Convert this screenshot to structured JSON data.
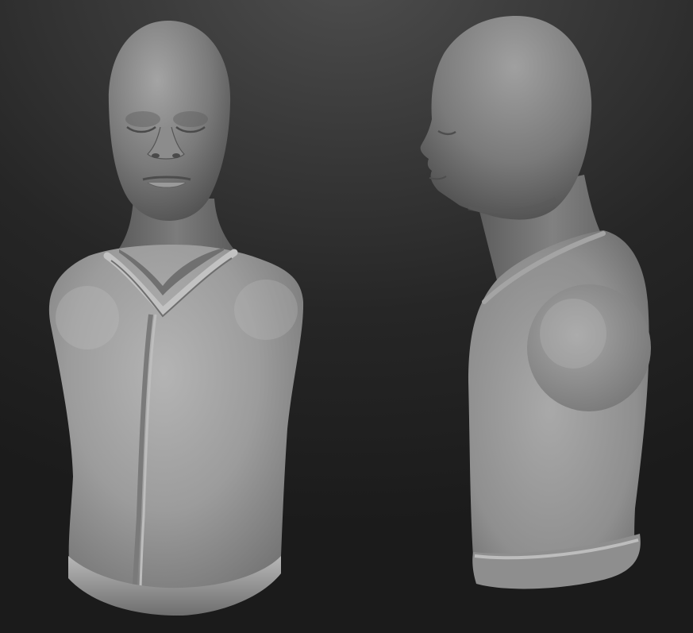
{
  "scene": {
    "background_color_top": "#4e4e4e",
    "background_color_bottom": "#1b1b1b",
    "material_color": "#8a8a8a",
    "models": [
      {
        "view": "front",
        "subject": "bust-sculpt"
      },
      {
        "view": "side",
        "subject": "bust-sculpt"
      }
    ]
  }
}
